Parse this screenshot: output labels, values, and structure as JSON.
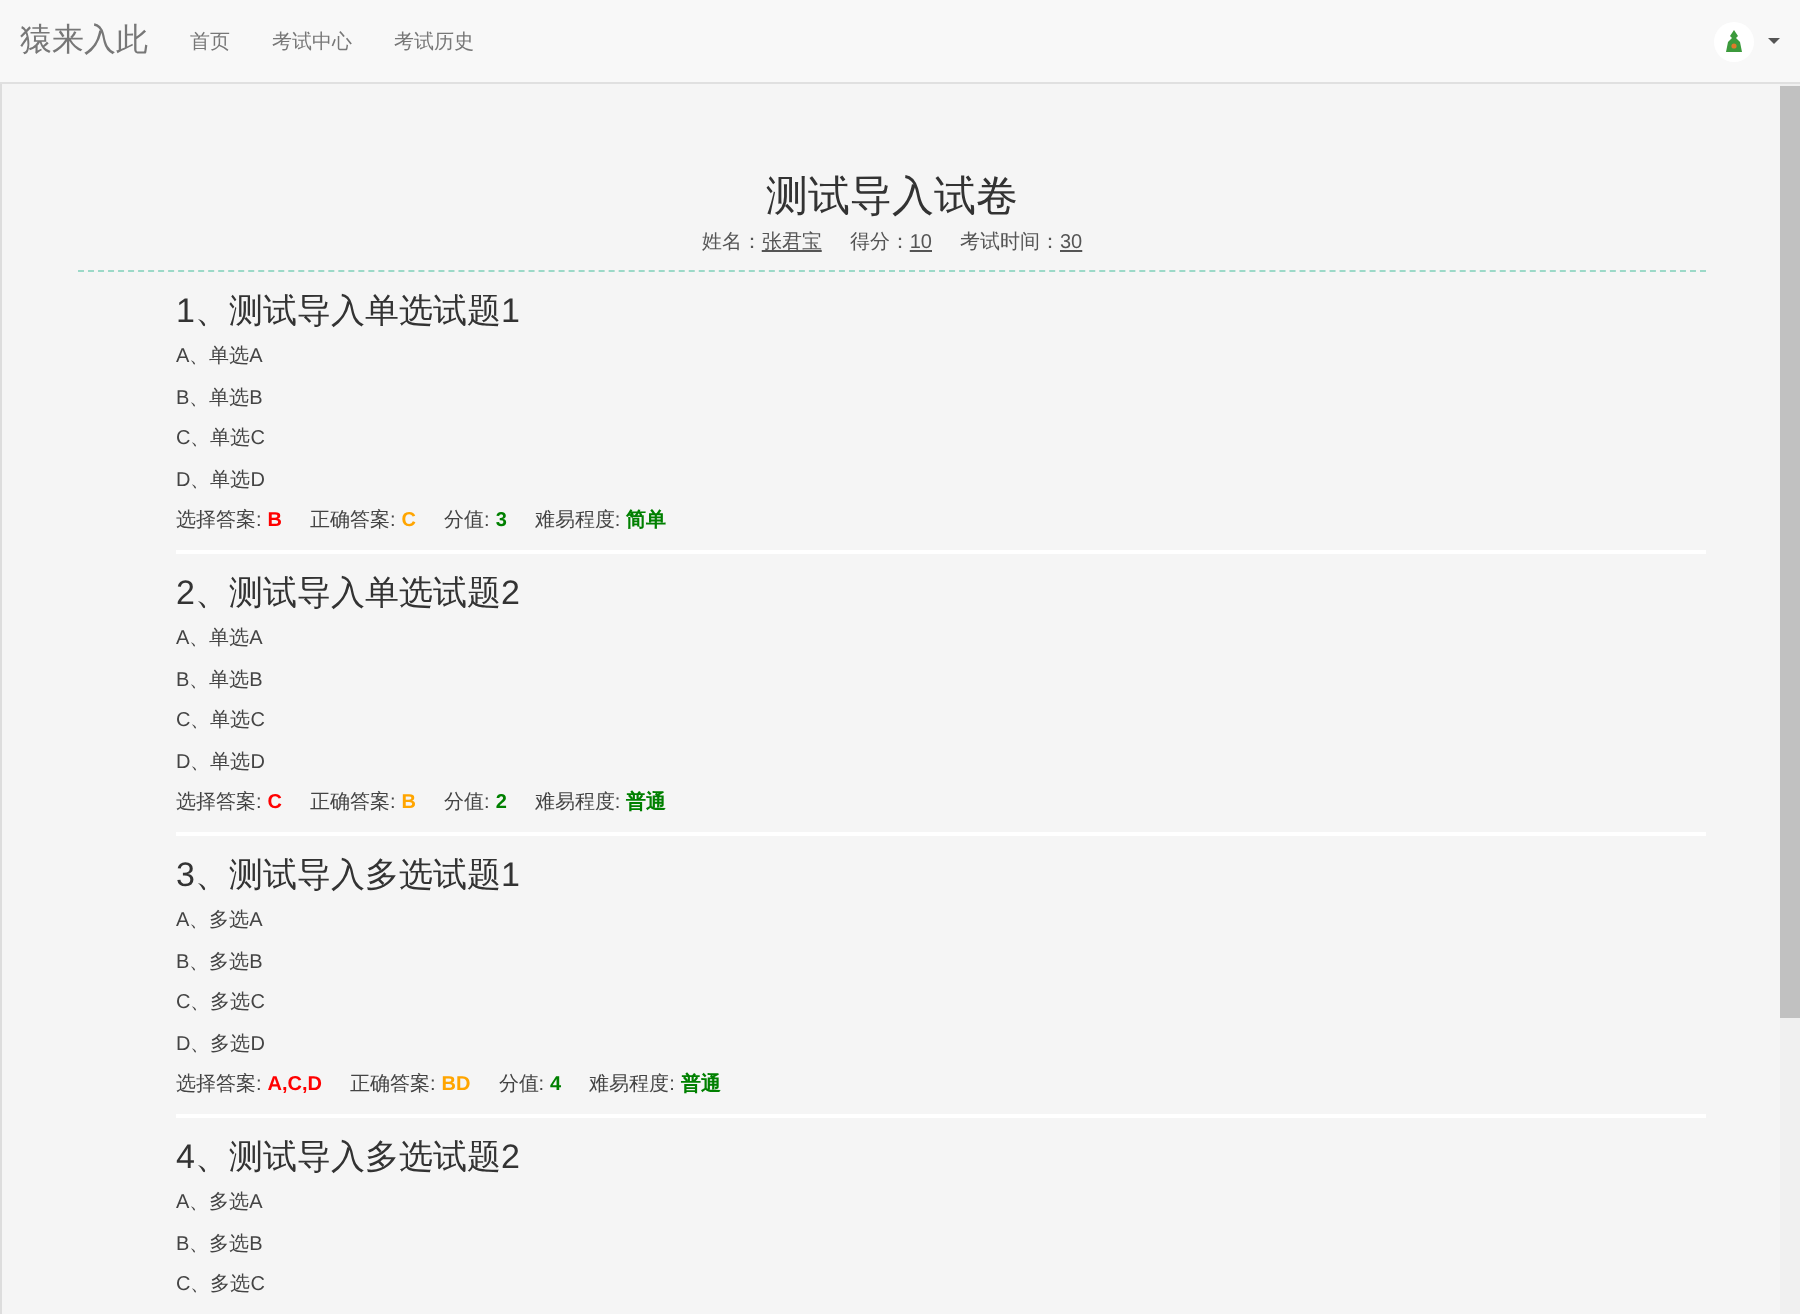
{
  "navbar": {
    "brand": "猿来入此",
    "links": [
      "首页",
      "考试中心",
      "考试历史"
    ]
  },
  "paper": {
    "title": "测试导入试卷",
    "meta": [
      {
        "label": "姓名：",
        "value": "张君宝"
      },
      {
        "label": "得分：",
        "value": "10"
      },
      {
        "label": "考试时间：",
        "value": "30"
      }
    ]
  },
  "questions": [
    {
      "title": "1、测试导入单选试题1",
      "options": [
        "A、单选A",
        "B、单选B",
        "C、单选C",
        "D、单选D"
      ],
      "info": [
        {
          "label": "选择答案:",
          "value": "B",
          "color": "#ff0000"
        },
        {
          "label": "正确答案:",
          "value": "C",
          "color": "#ffa500"
        },
        {
          "label": "分值:",
          "value": "3",
          "color": "#008000"
        },
        {
          "label": "难易程度:",
          "value": "简单",
          "color": "#008000"
        }
      ]
    },
    {
      "title": "2、测试导入单选试题2",
      "options": [
        "A、单选A",
        "B、单选B",
        "C、单选C",
        "D、单选D"
      ],
      "info": [
        {
          "label": "选择答案:",
          "value": "C",
          "color": "#ff0000"
        },
        {
          "label": "正确答案:",
          "value": "B",
          "color": "#ffa500"
        },
        {
          "label": "分值:",
          "value": "2",
          "color": "#008000"
        },
        {
          "label": "难易程度:",
          "value": "普通",
          "color": "#008000"
        }
      ]
    },
    {
      "title": "3、测试导入多选试题1",
      "options": [
        "A、多选A",
        "B、多选B",
        "C、多选C",
        "D、多选D"
      ],
      "info": [
        {
          "label": "选择答案:",
          "value": "A,C,D",
          "color": "#ff0000"
        },
        {
          "label": "正确答案:",
          "value": "BD",
          "color": "#ffa500"
        },
        {
          "label": "分值:",
          "value": "4",
          "color": "#008000"
        },
        {
          "label": "难易程度:",
          "value": "普通",
          "color": "#008000"
        }
      ]
    },
    {
      "title": "4、测试导入多选试题2",
      "options": [
        "A、多选A",
        "B、多选B",
        "C、多选C"
      ]
    }
  ]
}
